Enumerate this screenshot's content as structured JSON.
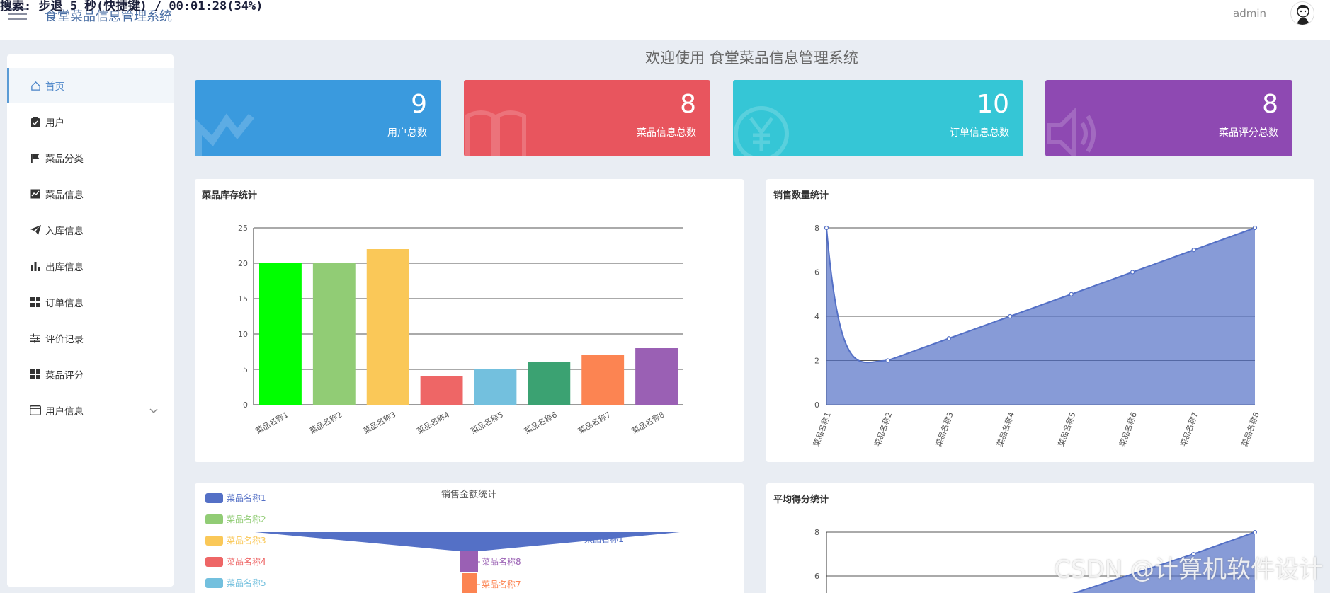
{
  "overlay": {
    "text": "搜索: 步退 5 秒(快捷键) / 00:01:28(34%)"
  },
  "header": {
    "title": "食堂菜品信息管理系统",
    "user": "admin"
  },
  "sidebar": {
    "items": [
      {
        "label": "首页",
        "icon": "home-icon",
        "active": true
      },
      {
        "label": "用户",
        "icon": "clipboard-icon"
      },
      {
        "label": "菜品分类",
        "icon": "flag-icon"
      },
      {
        "label": "菜品信息",
        "icon": "chart-icon"
      },
      {
        "label": "入库信息",
        "icon": "paper-plane-icon"
      },
      {
        "label": "出库信息",
        "icon": "bar-chart-icon"
      },
      {
        "label": "订单信息",
        "icon": "grid-icon"
      },
      {
        "label": "评价记录",
        "icon": "sliders-icon"
      },
      {
        "label": "菜品评分",
        "icon": "grid-icon"
      },
      {
        "label": "用户信息",
        "icon": "card-icon",
        "expandable": true
      }
    ]
  },
  "welcome": "欢迎使用 食堂菜品信息管理系统",
  "stats": [
    {
      "value": "9",
      "label": "用户总数",
      "color": "#3a9ade"
    },
    {
      "value": "8",
      "label": "菜品信息总数",
      "color": "#e8555e"
    },
    {
      "value": "10",
      "label": "订单信息总数",
      "color": "#35c6d6"
    },
    {
      "value": "8",
      "label": "菜品评分总数",
      "color": "#8e49b2"
    }
  ],
  "panels": {
    "stock": {
      "title": "菜品库存统计"
    },
    "sales_qty": {
      "title": "销售数量统计"
    },
    "sales_amount": {
      "title": "销售金额统计"
    },
    "avg_score": {
      "title": "平均得分统计"
    }
  },
  "chart_data": [
    {
      "type": "bar",
      "title": "菜品库存统计",
      "categories": [
        "菜品名称1",
        "菜品名称2",
        "菜品名称3",
        "菜品名称4",
        "菜品名称5",
        "菜品名称6",
        "菜品名称7",
        "菜品名称8"
      ],
      "values": [
        20,
        20,
        22,
        4,
        5,
        6,
        7,
        8
      ],
      "colors": [
        "#00ff00",
        "#91cc75",
        "#fac858",
        "#ee6666",
        "#73c0de",
        "#3ba272",
        "#fc8452",
        "#9a60b4"
      ],
      "ylim": [
        0,
        25
      ],
      "yticks": [
        0,
        5,
        10,
        15,
        20,
        25
      ]
    },
    {
      "type": "area",
      "title": "销售数量统计",
      "categories": [
        "菜品名称1",
        "菜品名称2",
        "菜品名称3",
        "菜品名称4",
        "菜品名称5",
        "菜品名称6",
        "菜品名称7",
        "菜品名称8"
      ],
      "values": [
        8,
        2,
        3,
        4,
        5,
        6,
        7,
        8
      ],
      "color": "#5470c6",
      "ylim": [
        0,
        8
      ],
      "yticks": [
        0,
        2,
        4,
        6,
        8
      ]
    },
    {
      "type": "funnel",
      "title": "销售金额统计",
      "legend": [
        "菜品名称1",
        "菜品名称2",
        "菜品名称3",
        "菜品名称4",
        "菜品名称5"
      ],
      "legend_colors": [
        "#5470c6",
        "#91cc75",
        "#fac858",
        "#ee6666",
        "#73c0de"
      ],
      "visible_labels": [
        "菜品名称1",
        "菜品名称8",
        "菜品名称7"
      ],
      "visible_label_colors": [
        "#5470c6",
        "#9a60b4",
        "#fc8452"
      ]
    },
    {
      "type": "area",
      "title": "平均得分统计",
      "yticks_visible": [
        6,
        8
      ],
      "color": "#5470c6"
    }
  ],
  "watermark": "CSDN @计算机软件设计"
}
